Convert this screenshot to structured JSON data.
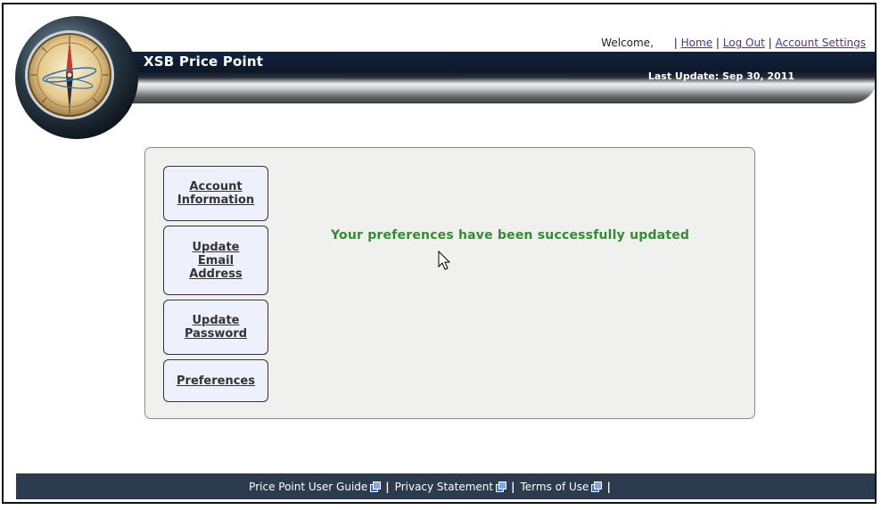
{
  "header": {
    "app_title": "XSB Price Point",
    "welcome": "Welcome,",
    "links": {
      "home": "Home",
      "logout": "Log Out",
      "account_settings": "Account Settings"
    },
    "last_update": "Last Update: Sep 30, 2011"
  },
  "sidebar": {
    "items": [
      {
        "label_lines": [
          "Account",
          "Information"
        ]
      },
      {
        "label_lines": [
          "Update",
          "Email",
          "Address"
        ]
      },
      {
        "label_lines": [
          "Update",
          "Password"
        ]
      },
      {
        "label_lines": [
          "Preferences"
        ]
      }
    ]
  },
  "main": {
    "message": "Your preferences have been successfully updated"
  },
  "footer": {
    "links": [
      "Price Point User Guide",
      "Privacy Statement",
      "Terms of Use"
    ]
  },
  "colors": {
    "success": "#2f8f2f",
    "footer_bg": "#2c3b4d",
    "button_bg": "#eef0fb",
    "panel_bg": "#f0f0ef"
  },
  "icons": {
    "logo": "compass-logo-icon",
    "external_link": "external-link-icon",
    "cursor": "mouse-pointer-icon"
  }
}
